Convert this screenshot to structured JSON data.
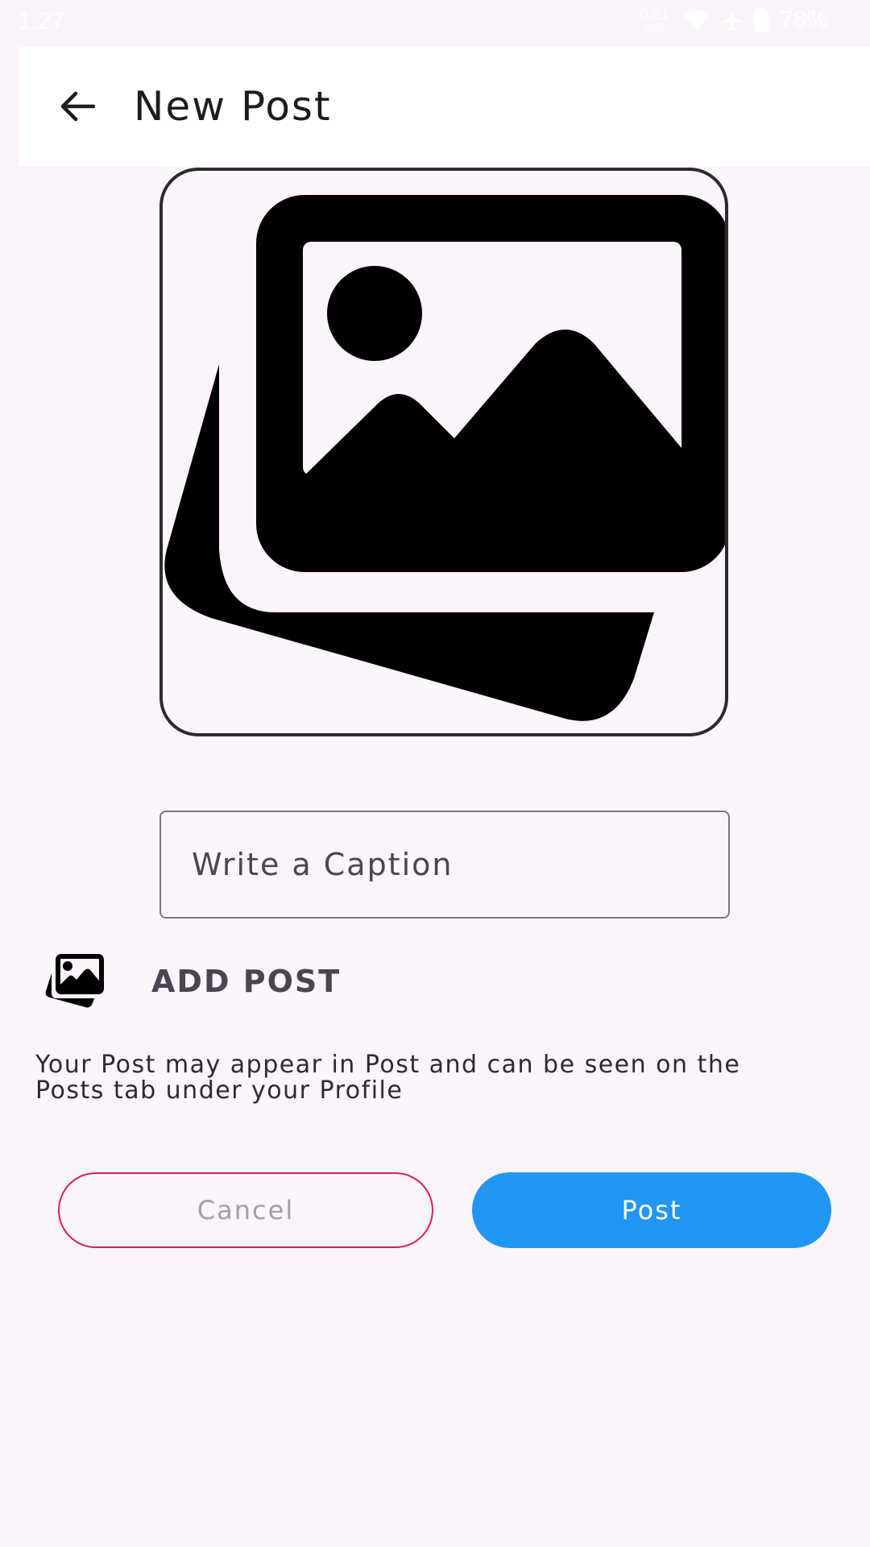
{
  "status_bar": {
    "time": "1:27",
    "net_speed": "0.21",
    "net_unit": "KB/s",
    "battery": "78%"
  },
  "app_bar": {
    "back_icon": "arrow-back-icon",
    "title": "New Post"
  },
  "image_picker": {
    "icon": "photo-library-icon"
  },
  "caption": {
    "placeholder": "Write a Caption",
    "value": ""
  },
  "add_post": {
    "icon": "photo-library-icon",
    "label": "ADD POST"
  },
  "info": {
    "text": "Your Post may appear in Post and can be seen on the Posts tab under your Profile"
  },
  "actions": {
    "cancel_label": "Cancel",
    "post_label": "Post"
  },
  "colors": {
    "background": "#fcf4fb",
    "app_bar": "#ffffff",
    "cancel_border": "#d81b60",
    "post_button": "#2196f3"
  }
}
